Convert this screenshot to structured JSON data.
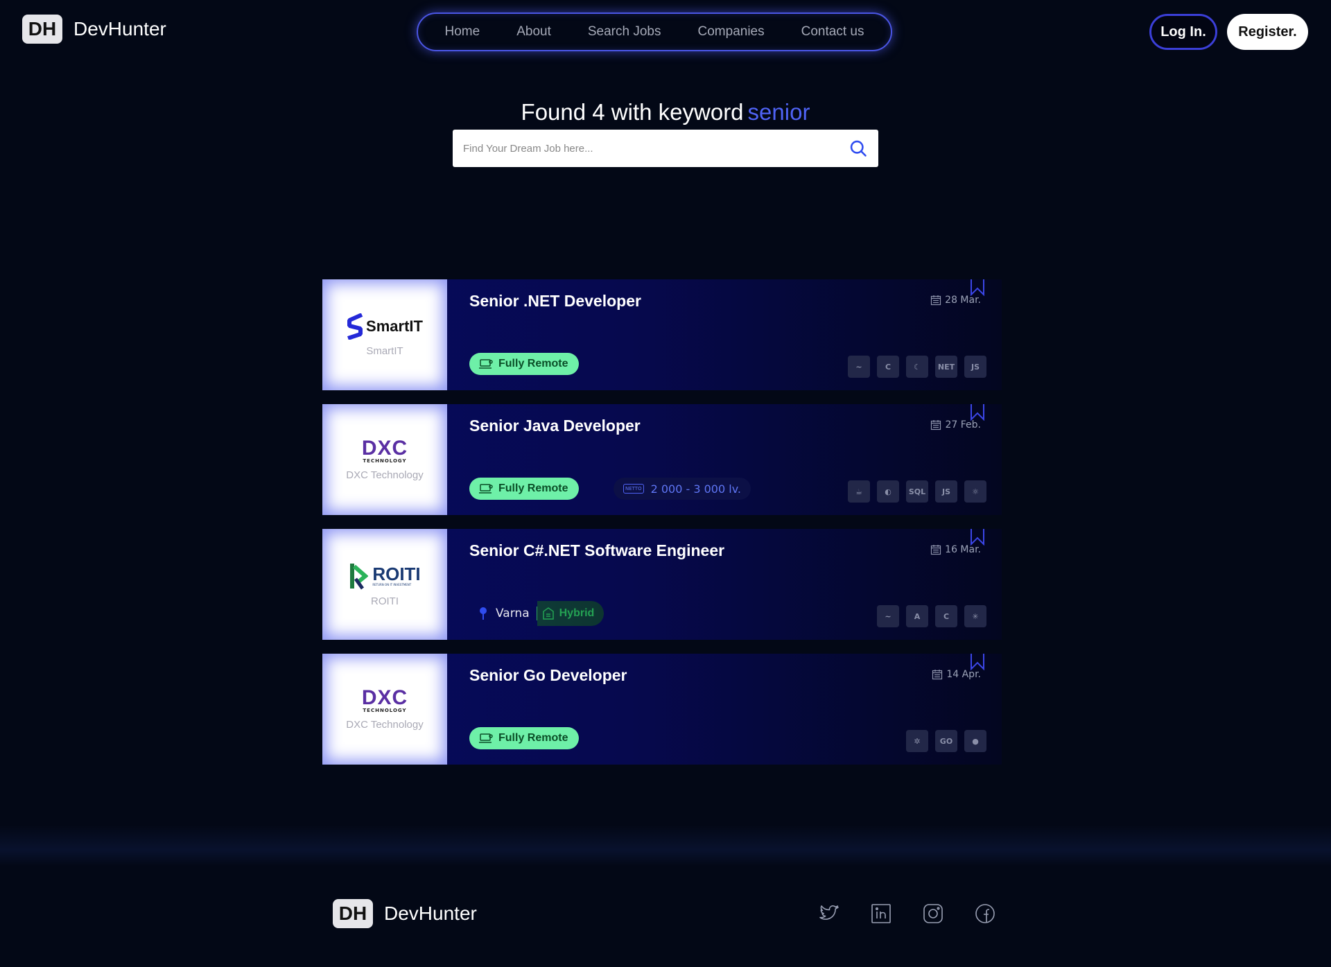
{
  "brand": {
    "badge": "DH",
    "name": "DevHunter"
  },
  "nav": {
    "items": [
      "Home",
      "About",
      "Search Jobs",
      "Companies",
      "Contact us"
    ]
  },
  "auth": {
    "login": "Log In.",
    "register": "Register."
  },
  "search": {
    "prefix": "Found 4 with keyword",
    "keyword": "senior",
    "placeholder": "Find Your Dream Job here..."
  },
  "jobs": [
    {
      "title": "Senior .NET Developer",
      "company": "SmartIT",
      "logo_text": "SmartIT",
      "date": "28 Mar.",
      "work_mode": "Fully Remote",
      "tech": [
        "~",
        "C",
        "☾",
        "NET",
        "JS"
      ]
    },
    {
      "title": "Senior Java Developer",
      "company": "DXC Technology",
      "logo_text": "DXC",
      "logo_sub": "TECHNOLOGY",
      "date": "27 Feb.",
      "work_mode": "Fully Remote",
      "salary_tag": "NETTO",
      "salary": "2 000 - 3 000 lv.",
      "tech": [
        "☕",
        "◐",
        "SQL",
        "JS",
        "⚛"
      ]
    },
    {
      "title": "Senior C#.NET Software Engineer",
      "company": "ROITI",
      "logo_text": "ROITI",
      "logo_sub": "RETURN ON IT INVESTMENT",
      "date": "16 Mar.",
      "city": "Varna",
      "work_mode": "Hybrid",
      "tech": [
        "~",
        "A",
        "C",
        "✳"
      ]
    },
    {
      "title": "Senior Go Developer",
      "company": "DXC Technology",
      "logo_text": "DXC",
      "logo_sub": "TECHNOLOGY",
      "date": "14 Apr.",
      "work_mode": "Fully Remote",
      "tech": [
        "✲",
        "GO",
        "●"
      ]
    }
  ],
  "footer": {
    "badge": "DH",
    "name": "DevHunter",
    "social": [
      "twitter",
      "linkedin",
      "instagram",
      "facebook"
    ]
  },
  "colors": {
    "accent": "#4f63f5",
    "remote_pill": "#6ef0a8",
    "background": "#030816"
  }
}
